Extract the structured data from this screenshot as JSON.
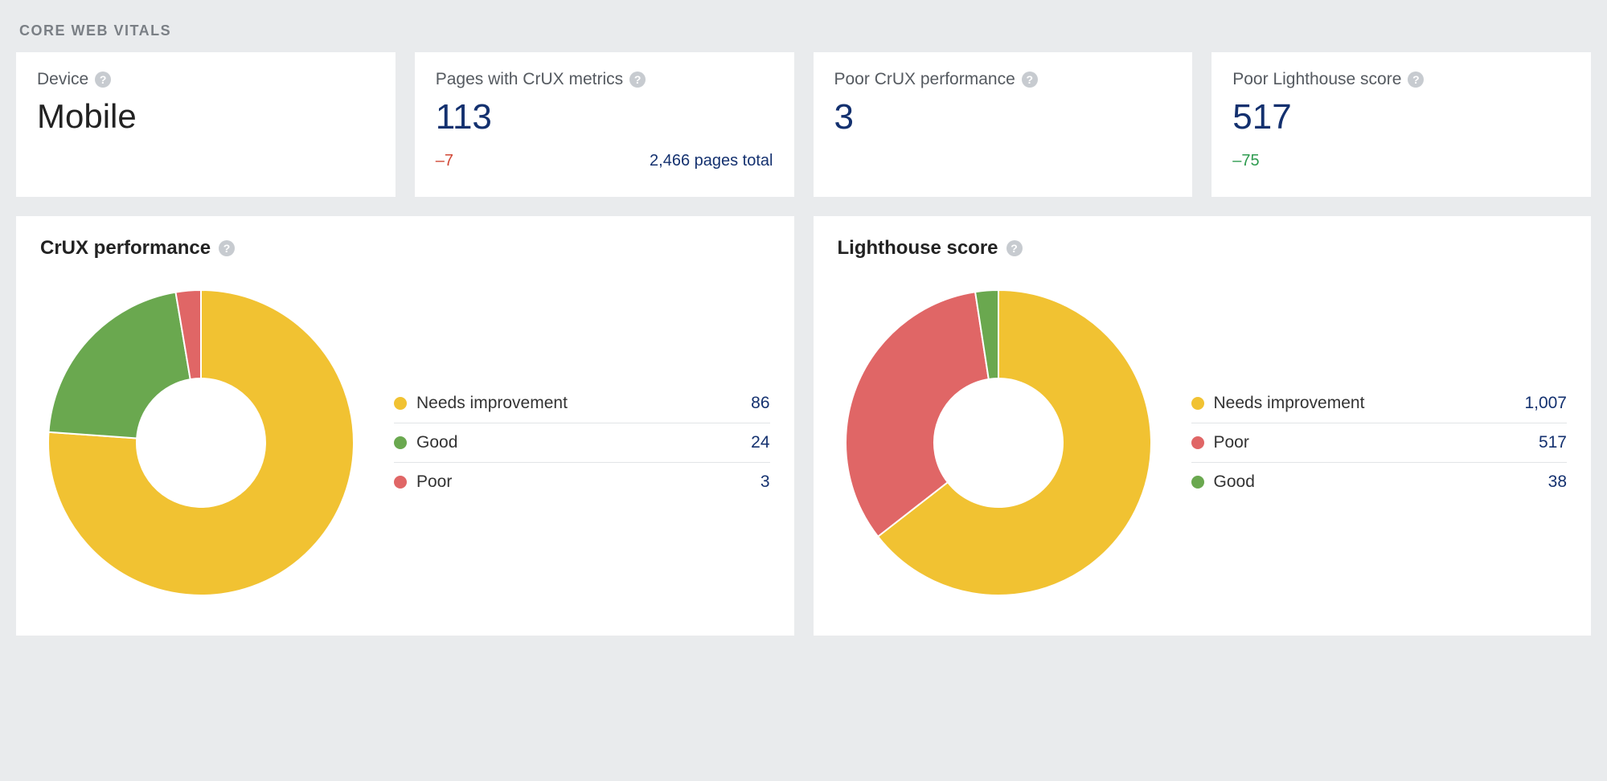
{
  "section_title": "CORE WEB VITALS",
  "colors": {
    "needs_improvement": "#f1c232",
    "good": "#6aa84f",
    "poor": "#e06666"
  },
  "cards": {
    "device": {
      "label": "Device",
      "value": "Mobile"
    },
    "pages_crux": {
      "label": "Pages with CrUX metrics",
      "value": "113",
      "delta": "–7",
      "delta_class": "delta-neg",
      "extra": "2,466 pages total"
    },
    "poor_crux": {
      "label": "Poor CrUX performance",
      "value": "3"
    },
    "poor_lighthouse": {
      "label": "Poor Lighthouse score",
      "value": "517",
      "delta": "–75",
      "delta_class": "delta-pos"
    }
  },
  "chart_data": [
    {
      "id": "crux",
      "type": "pie",
      "title": "CrUX performance",
      "series": [
        {
          "name": "Needs improvement",
          "value": 86,
          "display": "86",
          "color_key": "needs_improvement"
        },
        {
          "name": "Good",
          "value": 24,
          "display": "24",
          "color_key": "good"
        },
        {
          "name": "Poor",
          "value": 3,
          "display": "3",
          "color_key": "poor"
        }
      ]
    },
    {
      "id": "lighthouse",
      "type": "pie",
      "title": "Lighthouse score",
      "series": [
        {
          "name": "Needs improvement",
          "value": 1007,
          "display": "1,007",
          "color_key": "needs_improvement"
        },
        {
          "name": "Poor",
          "value": 517,
          "display": "517",
          "color_key": "poor"
        },
        {
          "name": "Good",
          "value": 38,
          "display": "38",
          "color_key": "good"
        }
      ]
    }
  ]
}
